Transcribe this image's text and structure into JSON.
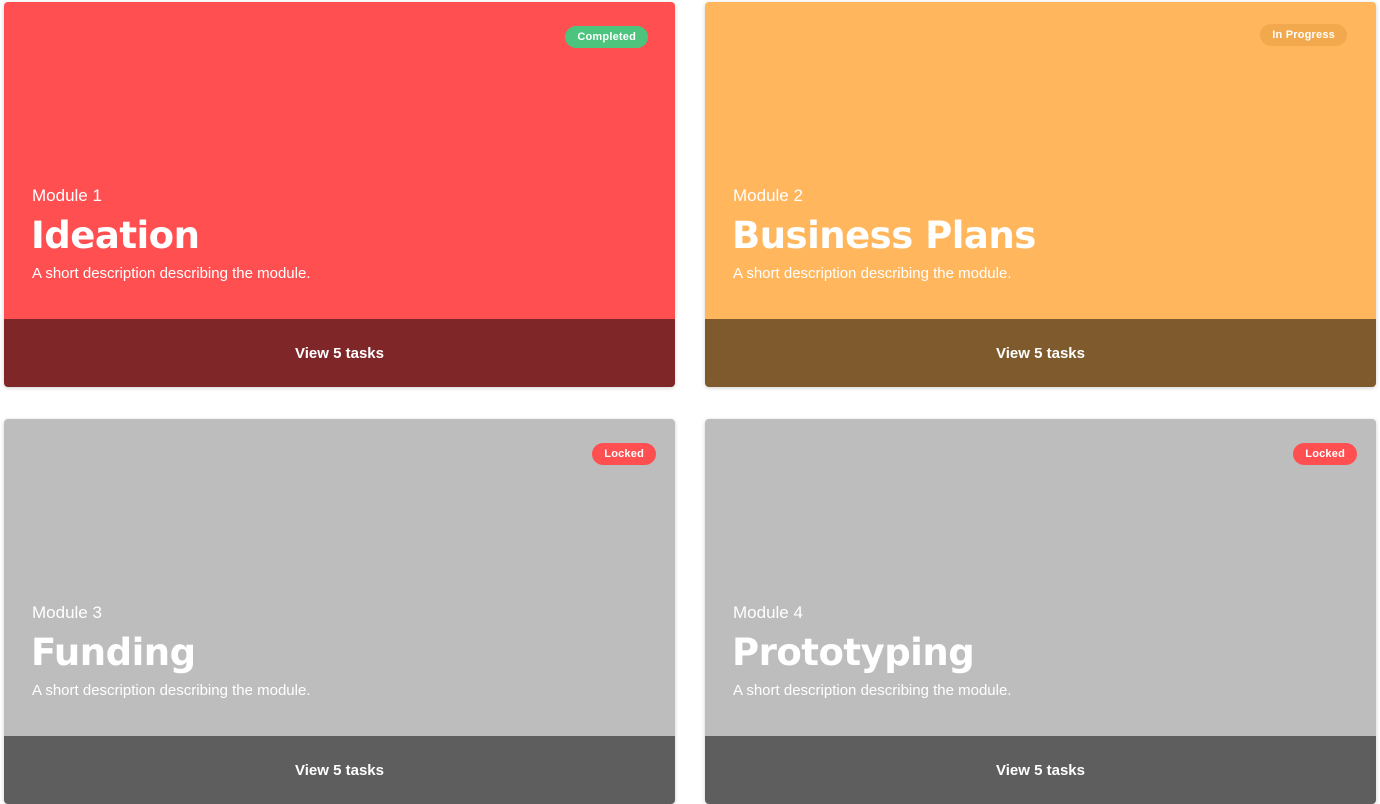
{
  "modules": [
    {
      "number_label": "Module 1",
      "title": "Ideation",
      "description": "A short description describing the module.",
      "status": "Completed",
      "action_label": "View 5 tasks",
      "colors": {
        "body": "#ff4f51",
        "footer": "#7f2628",
        "badge": "#4cc47e",
        "badge_text": "#ffffff"
      }
    },
    {
      "number_label": "Module 2",
      "title": "Business Plans",
      "description": "A short description describing the module.",
      "status": "In Progress",
      "action_label": "View 5 tasks",
      "colors": {
        "body": "#ffb65c",
        "footer": "#7f5a2c",
        "badge": "#f2a94e",
        "badge_text": "#ffffff"
      }
    },
    {
      "number_label": "Module 3",
      "title": "Funding",
      "description": "A short description describing the module.",
      "status": "Locked",
      "action_label": "View 5 tasks",
      "colors": {
        "body": "#bdbdbd",
        "footer": "#5e5e5e",
        "badge": "#ff4f51",
        "badge_text": "#ffffff"
      }
    },
    {
      "number_label": "Module 4",
      "title": "Prototyping",
      "description": "A short description describing the module.",
      "status": "Locked",
      "action_label": "View 5 tasks",
      "colors": {
        "body": "#bdbdbd",
        "footer": "#5e5e5e",
        "badge": "#ff4f51",
        "badge_text": "#ffffff"
      }
    }
  ]
}
